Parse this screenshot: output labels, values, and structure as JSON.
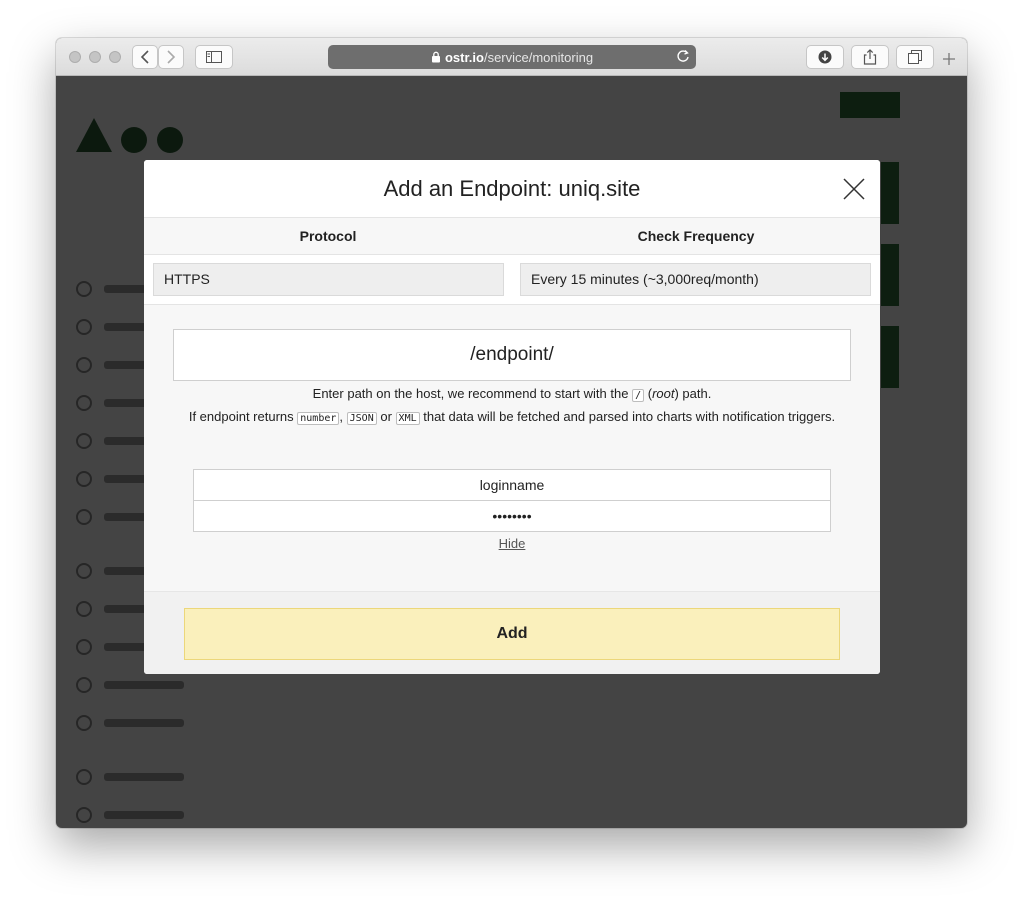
{
  "browser": {
    "url_host": "ostr.io",
    "url_path": "/service/monitoring"
  },
  "modal": {
    "title": "Add an Endpoint: uniq.site",
    "protocol_header": "Protocol",
    "frequency_header": "Check Frequency",
    "protocol_value": "HTTPS",
    "frequency_value": "Every 15 minutes (~3,000req/month)",
    "path_value": "/endpoint/",
    "hint": {
      "line1_before": "Enter path on the host, we recommend to start with the",
      "root_code": "/",
      "root_open": "(",
      "root_word": "root",
      "line1_after": ") path.",
      "line2_before": "If endpoint returns",
      "code_number": "number",
      "comma": ",",
      "code_json": "JSON",
      "or_word": "or",
      "code_xml": "XML",
      "line2_after": "that data will be fetched and parsed into charts with notification triggers."
    },
    "login_value": "loginname",
    "password_value": "••••••••",
    "hide_label": "Hide",
    "add_label": "Add"
  },
  "colors": {
    "add_button": "#faf0bc",
    "overlay": "#000000"
  }
}
